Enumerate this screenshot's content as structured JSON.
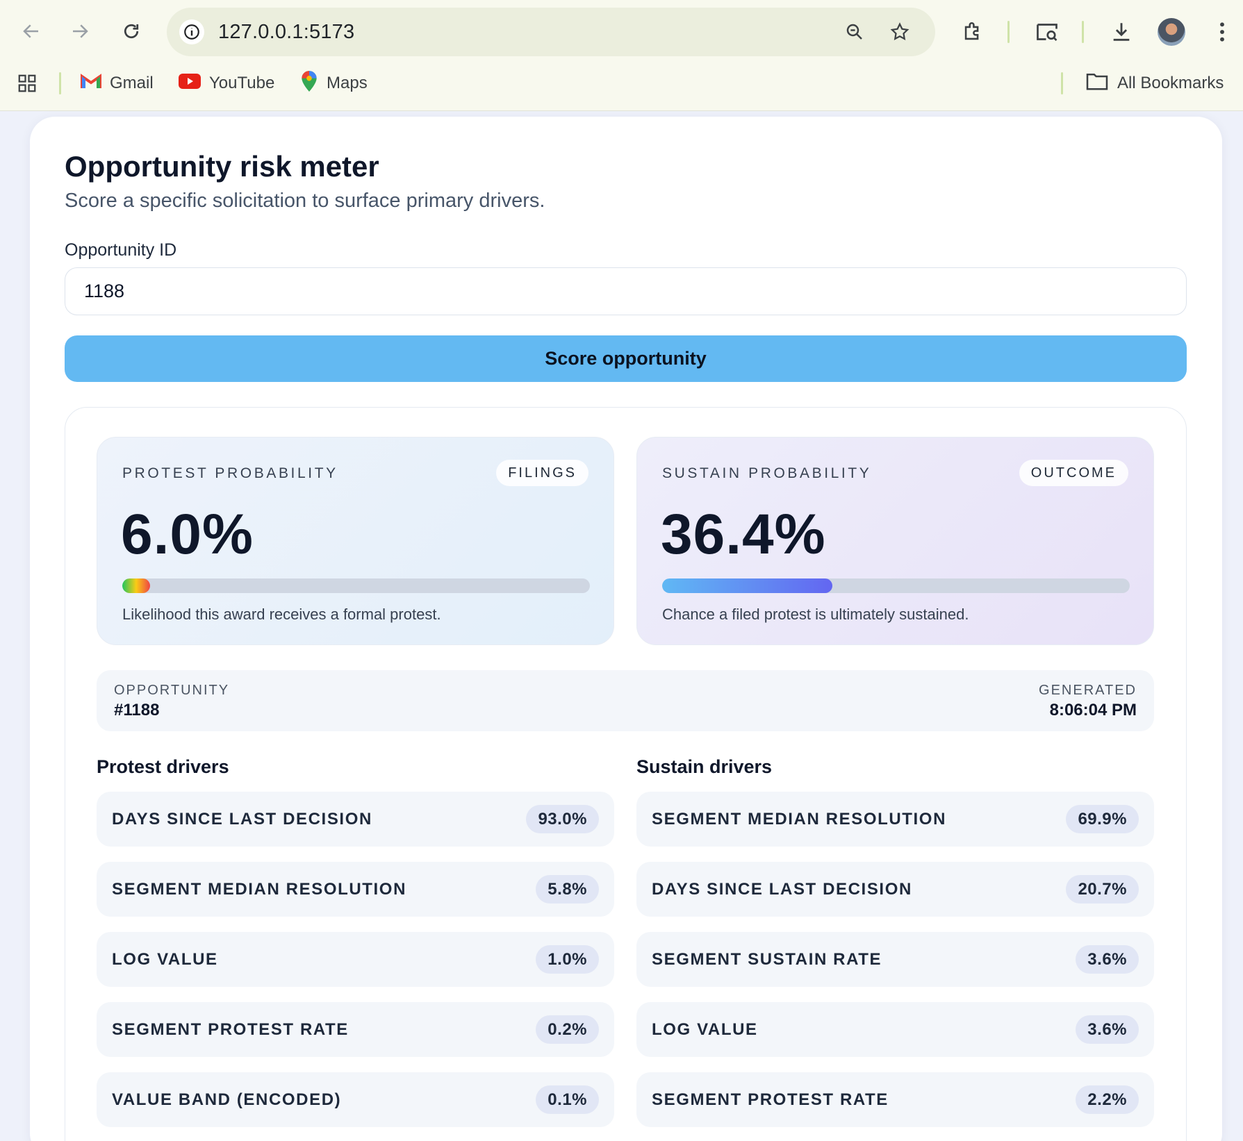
{
  "browser": {
    "url": "127.0.0.1:5173",
    "bookmarks": [
      {
        "label": "Gmail"
      },
      {
        "label": "YouTube"
      },
      {
        "label": "Maps"
      }
    ],
    "all_bookmarks_label": "All Bookmarks"
  },
  "page": {
    "title": "Opportunity risk meter",
    "subtitle": "Score a specific solicitation to surface primary drivers.",
    "field_label": "Opportunity ID",
    "opportunity_id_value": "1188",
    "score_button": "Score opportunity"
  },
  "metrics": {
    "protest": {
      "label": "PROTEST PROBABILITY",
      "tag": "FILINGS",
      "value": "6.0%",
      "fraction": 0.06,
      "description": "Likelihood this award receives a formal protest."
    },
    "sustain": {
      "label": "SUSTAIN PROBABILITY",
      "tag": "OUTCOME",
      "value": "36.4%",
      "fraction": 0.364,
      "description": "Chance a filed protest is ultimately sustained."
    }
  },
  "meta": {
    "opportunity_label": "OPPORTUNITY",
    "opportunity_value": "#1188",
    "generated_label": "GENERATED",
    "generated_value": "8:06:04 PM"
  },
  "protest_drivers": {
    "heading": "Protest drivers",
    "items": [
      {
        "name": "DAYS SINCE LAST DECISION",
        "value": "93.0%"
      },
      {
        "name": "SEGMENT MEDIAN RESOLUTION",
        "value": "5.8%"
      },
      {
        "name": "LOG VALUE",
        "value": "1.0%"
      },
      {
        "name": "SEGMENT PROTEST RATE",
        "value": "0.2%"
      },
      {
        "name": "VALUE BAND (ENCODED)",
        "value": "0.1%"
      }
    ]
  },
  "sustain_drivers": {
    "heading": "Sustain drivers",
    "items": [
      {
        "name": "SEGMENT MEDIAN RESOLUTION",
        "value": "69.9%"
      },
      {
        "name": "DAYS SINCE LAST DECISION",
        "value": "20.7%"
      },
      {
        "name": "SEGMENT SUSTAIN RATE",
        "value": "3.6%"
      },
      {
        "name": "LOG VALUE",
        "value": "3.6%"
      },
      {
        "name": "SEGMENT PROTEST RATE",
        "value": "2.2%"
      }
    ]
  },
  "colors": {
    "button": "#63b9f2",
    "protest_bar": [
      "#22c55e",
      "#facc15",
      "#ef4444"
    ],
    "sustain_bar": [
      "#60b8f4",
      "#6366f1"
    ]
  },
  "icons": [
    "back-arrow-icon",
    "forward-arrow-icon",
    "reload-icon",
    "site-info-icon",
    "zoom-icon",
    "star-icon",
    "extensions-icon",
    "tab-search-icon",
    "download-icon",
    "more-icon",
    "apps-grid-icon",
    "gmail-icon",
    "youtube-icon",
    "maps-icon",
    "folder-icon"
  ]
}
